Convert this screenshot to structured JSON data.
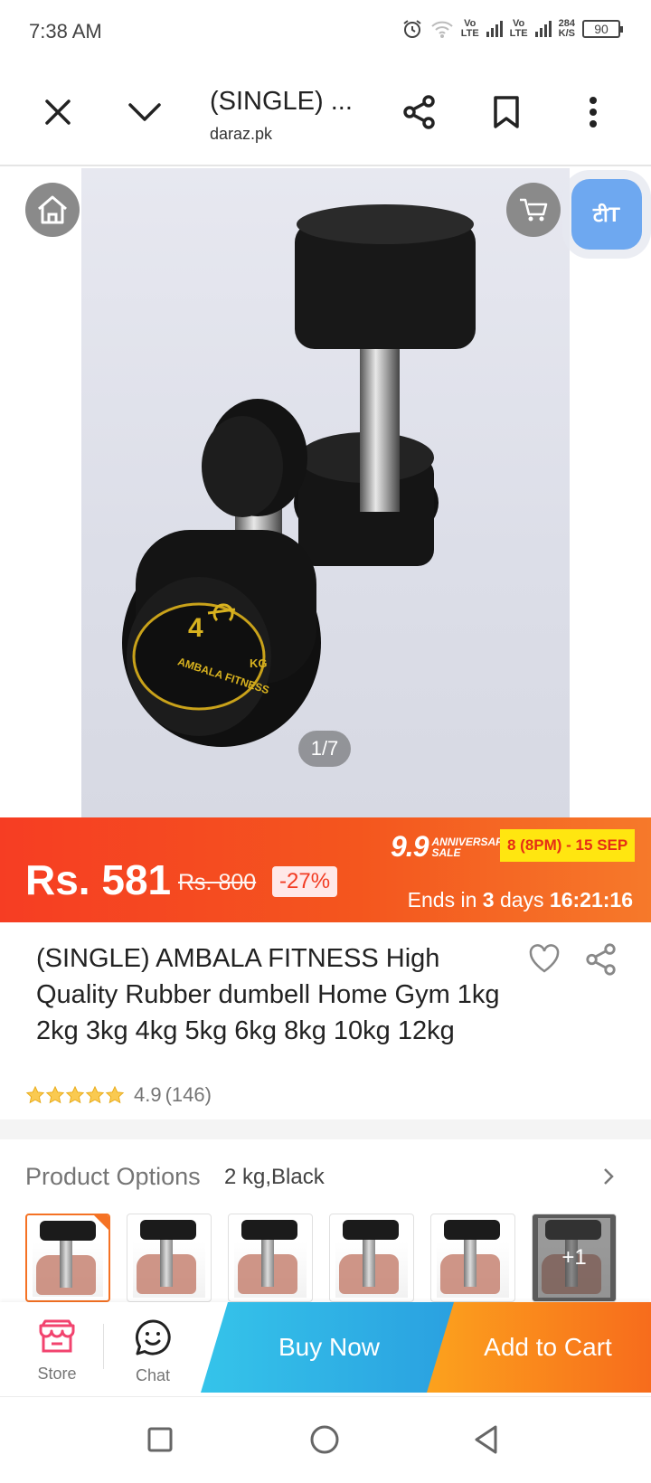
{
  "status_bar": {
    "time": "7:38 AM",
    "net1": [
      "Vo",
      "LTE"
    ],
    "net2": [
      "Vo",
      "LTE"
    ],
    "speed_value": "284",
    "speed_unit": "K/S",
    "battery": "90"
  },
  "browser": {
    "page_title": "(SINGLE) ...",
    "domain": "daraz.pk",
    "icons": [
      "close-icon",
      "chevron-down-icon",
      "share-icon",
      "bookmark-icon",
      "more-vert-icon"
    ]
  },
  "gallery": {
    "pager": "1/7",
    "translate_label": "टीT",
    "product_text": {
      "weight": "4",
      "unit": "KG",
      "brand": "AMBALA FITNESS"
    }
  },
  "price": {
    "current": "Rs. 581",
    "original": "Rs. 800",
    "discount": "-27%",
    "sale_number": "9.9",
    "sale_line1": "ANNIVERSARY",
    "sale_line2": "SALE",
    "sale_dates": "8 (8PM) - 15 SEP",
    "ends_prefix": "Ends in",
    "ends_days": "3",
    "ends_days_word": "days",
    "ends_time": "16:21:16",
    "colors": {
      "banner_start": "#f63d23",
      "banner_end": "#f6792a",
      "dates_bg": "#ffe610"
    }
  },
  "product": {
    "name": "(SINGLE) AMBALA FITNESS High Quality Rubber dumbell Home Gym 1kg 2kg 3kg 4kg 5kg 6kg 8kg 10kg 12kg",
    "rating": "4.9",
    "rating_count": "(146)",
    "stars": 4.9
  },
  "options": {
    "label": "Product Options",
    "selected": "2 kg,Black",
    "more_label": "+1"
  },
  "actions": {
    "store_label": "Store",
    "chat_label": "Chat",
    "buy_label": "Buy Now",
    "cart_label": "Add to Cart",
    "colors": {
      "accent": "#f57224",
      "buy": "#2aa0e0"
    }
  }
}
